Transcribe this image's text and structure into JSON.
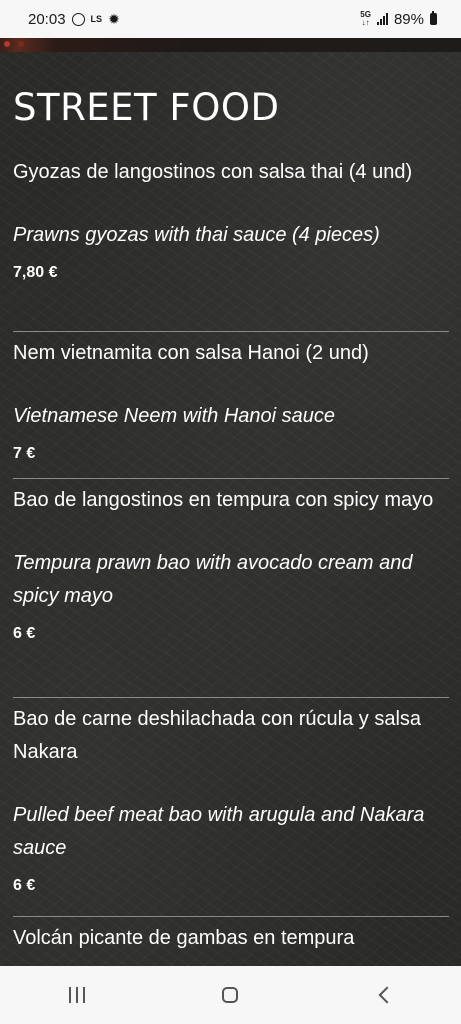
{
  "status_bar": {
    "time": "20:03",
    "ls": "LS",
    "network": "5G",
    "battery": "89%"
  },
  "menu": {
    "section_title": "STREET FOOD",
    "items": [
      {
        "name_es": "Gyozas de langostinos con salsa thai (4 und)",
        "name_en": "Prawns gyozas with thai sauce (4 pieces)",
        "price": "7,80 €"
      },
      {
        "name_es": "Nem vietnamita con salsa Hanoi (2 und)",
        "name_en": "Vietnamese Neem with Hanoi sauce",
        "price": "7 €"
      },
      {
        "name_es": "Bao de langostinos en tempura con spicy mayo",
        "name_en": " Tempura prawn bao with avocado cream and spicy mayo",
        "price": "6 €"
      },
      {
        "name_es": "Bao de carne deshilachada con rúcula y salsa Nakara",
        "name_en": "Pulled beef meat bao with arugula and Nakara sauce",
        "price": "6 €"
      },
      {
        "name_es": "Volcán picante de gambas en tempura"
      }
    ]
  },
  "icons": {
    "whatsapp": "whatsapp-icon",
    "brightness": "sun-icon",
    "signal": "signal-icon",
    "battery": "battery-icon",
    "recents": "recents-icon",
    "home": "home-icon",
    "back": "back-icon"
  },
  "colors": {
    "background": "#2a2a28",
    "text": "#ffffff",
    "divider": "#8a8a88"
  }
}
